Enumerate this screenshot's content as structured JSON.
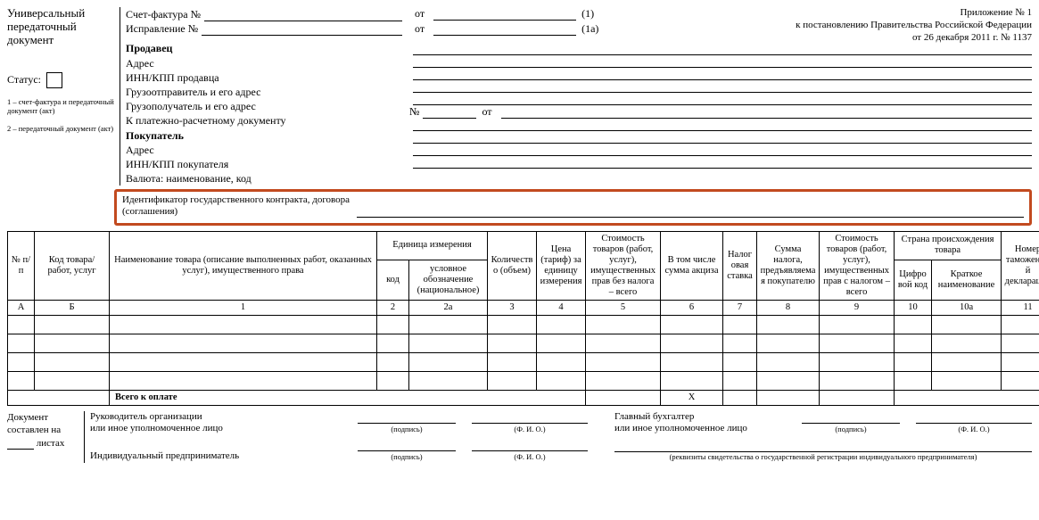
{
  "left": {
    "title_l1": "Универсальный",
    "title_l2": "передаточный",
    "title_l3": "документ",
    "status_label": "Статус:",
    "legend1": "1 – счет-фактура и передаточный документ (акт)",
    "legend2": "2 – передаточный документ (акт)"
  },
  "mid": {
    "invoice_no": "Счет-фактура №",
    "correction_no": "Исправление №",
    "ot": "от",
    "seller": "Продавец",
    "address": "Адрес",
    "inn_seller": "ИНН/КПП продавца",
    "consignor": "Грузоотправитель и его адрес",
    "consignee": "Грузополучатель и его адрес",
    "payment_doc": "К платежно-расчетному документу",
    "payment_no": "№",
    "buyer": "Покупатель",
    "address2": "Адрес",
    "inn_buyer": "ИНН/КПП покупателя",
    "currency": "Валюта: наименование, код"
  },
  "paren": {
    "one": "(1)",
    "onea": "(1a)"
  },
  "appendix": {
    "l1": "Приложение № 1",
    "l2": "к постановлению Правительства Российской Федерации",
    "l3": "от 26 декабря 2011 г. № 1137"
  },
  "highlight": {
    "label_l1": "Идентификатор государственного контракта, договора",
    "label_l2": "(соглашения)"
  },
  "table": {
    "headers": {
      "num": "№ п/п",
      "code": "Код товара/ работ, услуг",
      "name": "Наименование товара (описание выполненных работ, оказанных услуг), имущественного права",
      "unit_group": "Единица измерения",
      "unit_code": "код",
      "unit_name": "условное обозначение (национальное)",
      "qty": "Количество (объем)",
      "price": "Цена (тариф) за единицу измерения",
      "cost_no_tax": "Стоимость товаров (работ, услуг), имущественных прав без налога – всего",
      "excise": "В том числе сумма акциза",
      "tax_rate": "Налоговая ставка",
      "tax_amount": "Сумма налога, предъявляемая покупателю",
      "cost_with_tax": "Стоимость товаров (работ, услуг), имущественных прав с налогом – всего",
      "country_group": "Страна происхождения товара",
      "country_code": "Цифровой код",
      "country_name": "Краткое наименование",
      "decl": "Номер таможенной декларации"
    },
    "col_letters": {
      "A": "А",
      "B": "Б",
      "one": "1",
      "two": "2",
      "twoa": "2а",
      "three": "3",
      "four": "4",
      "five": "5",
      "six": "6",
      "seven": "7",
      "eight": "8",
      "nine": "9",
      "ten": "10",
      "tena": "10а",
      "eleven": "11"
    },
    "total_label": "Всего к оплате",
    "total_x": "X"
  },
  "footer": {
    "doc_on_l1": "Документ",
    "doc_on_l2": "составлен на",
    "sheets": "листах",
    "head": "Руководитель организации",
    "head_sub": "или иное уполномоченное лицо",
    "accountant": "Главный бухгалтер",
    "accountant_sub": "или иное уполномоченное лицо",
    "ip": "Индивидуальный предприниматель",
    "sign_sub": "(подпись)",
    "fio_sub": "(Ф. И. О.)",
    "ip_note": "(реквизиты свидетельства о государственной регистрации индивидуального предпринимателя)"
  }
}
